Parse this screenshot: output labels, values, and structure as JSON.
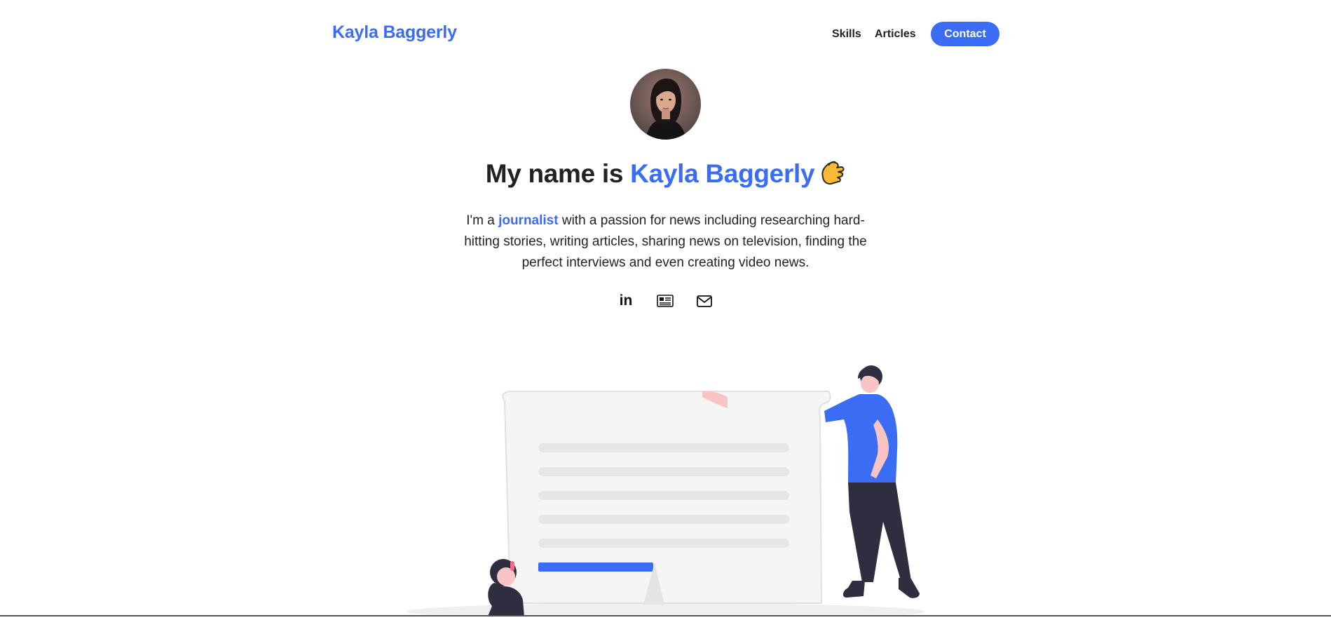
{
  "nav": {
    "brand": "Kayla Baggerly",
    "links": [
      {
        "label": "Skills"
      },
      {
        "label": "Articles"
      }
    ],
    "contact_label": "Contact"
  },
  "hero": {
    "avatar_alt": "Portrait of Kayla Baggerly",
    "headline_prefix": "My name is",
    "headline_name": "Kayla Baggerly",
    "bio_prefix": "I'm a",
    "bio_highlight": "journalist",
    "bio_rest": "with a passion for news including researching hard-hitting stories, writing articles, sharing news on television, finding the perfect interviews and even creating video news."
  },
  "social": [
    {
      "name": "linkedin-icon",
      "glyph": "in"
    },
    {
      "name": "newspaper-icon"
    },
    {
      "name": "envelope-icon"
    }
  ],
  "colors": {
    "accent": "#3a6cf4",
    "text": "#222222",
    "bubble": "#f5f5f5",
    "bar": "#e6e6e6",
    "shirt": "#3a6cf4",
    "pants": "#2f2e41"
  }
}
